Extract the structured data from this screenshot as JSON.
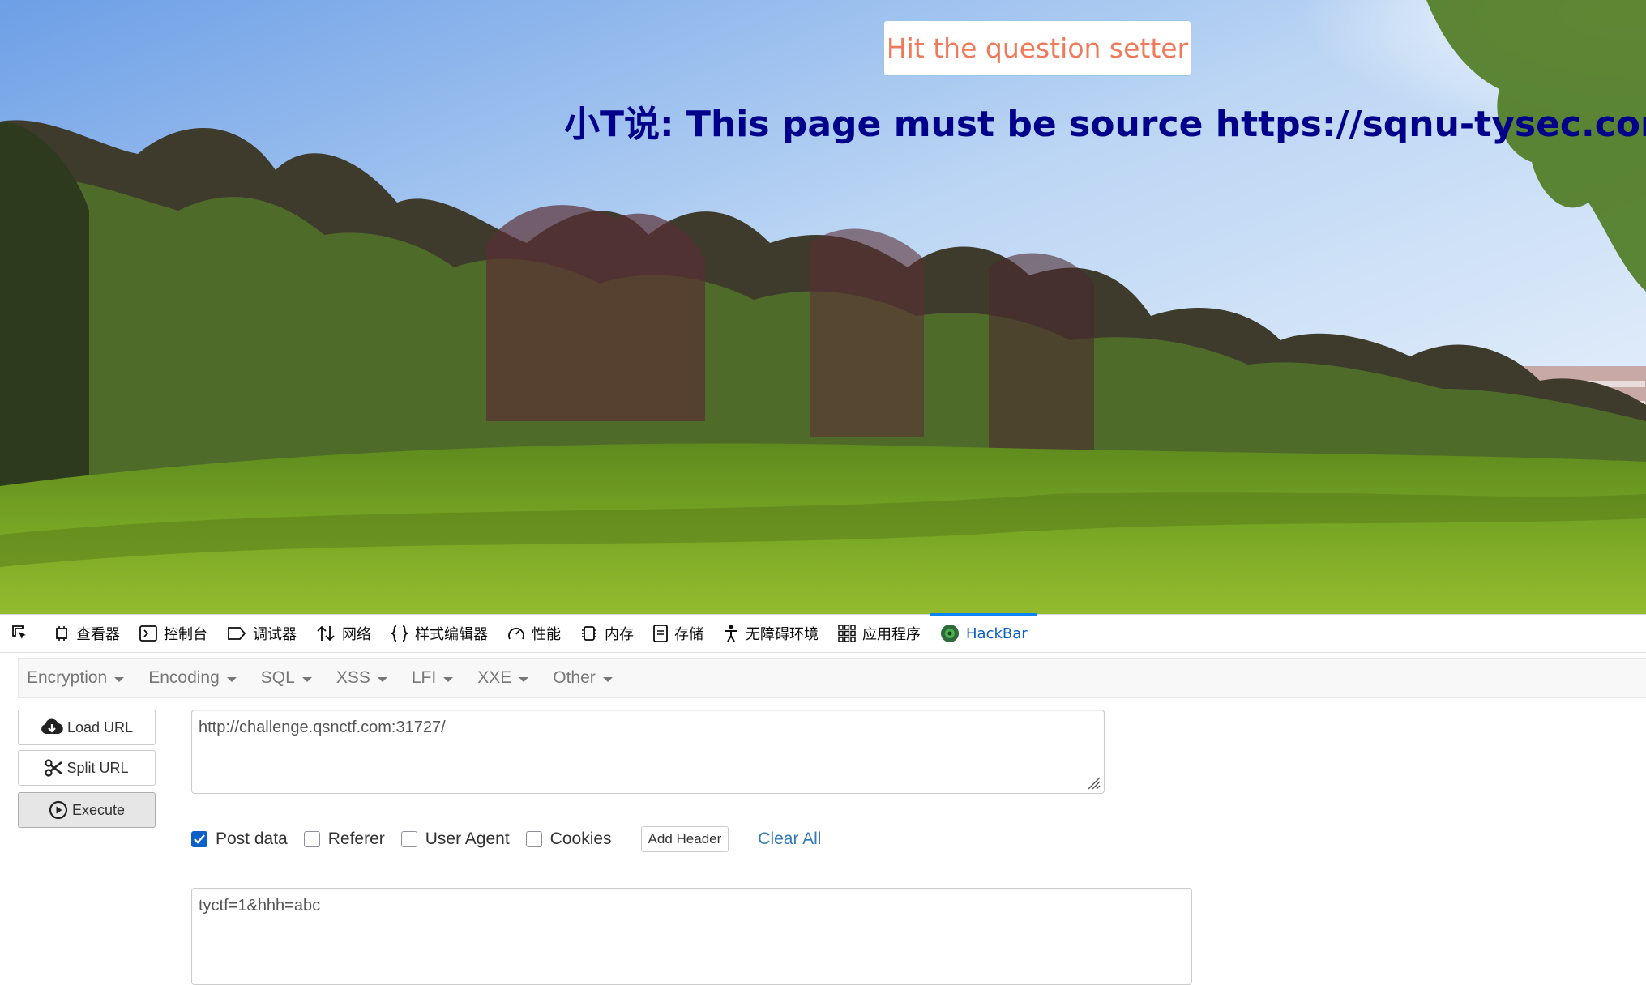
{
  "page": {
    "hit_button": "Hit the question setter",
    "headline": "小T说: This page must be source https://sqnu-tysec.com"
  },
  "devtools": {
    "tabs": [
      {
        "label": "查看器",
        "icon": "inspector-icon"
      },
      {
        "label": "控制台",
        "icon": "console-icon"
      },
      {
        "label": "调试器",
        "icon": "debugger-icon"
      },
      {
        "label": "网络",
        "icon": "network-icon"
      },
      {
        "label": "样式编辑器",
        "icon": "style-editor-icon"
      },
      {
        "label": "性能",
        "icon": "performance-icon"
      },
      {
        "label": "内存",
        "icon": "memory-icon"
      },
      {
        "label": "存储",
        "icon": "storage-icon"
      },
      {
        "label": "无障碍环境",
        "icon": "accessibility-icon"
      },
      {
        "label": "应用程序",
        "icon": "application-icon"
      },
      {
        "label": "HackBar",
        "icon": "hackbar-icon",
        "active": true
      }
    ]
  },
  "hackbar": {
    "menu": [
      "Encryption",
      "Encoding",
      "SQL",
      "XSS",
      "LFI",
      "XXE",
      "Other"
    ],
    "load_url": "Load URL",
    "split_url": "Split URL",
    "execute": "Execute",
    "url_value": "http://challenge.qsnctf.com:31727/",
    "options": [
      {
        "label": "Post data",
        "checked": true
      },
      {
        "label": "Referer",
        "checked": false
      },
      {
        "label": "User Agent",
        "checked": false
      },
      {
        "label": "Cookies",
        "checked": false
      }
    ],
    "add_header": "Add Header",
    "clear_all": "Clear All",
    "post_value": "tyctf=1&hhh=abc"
  },
  "colors": {
    "headline": "#00008b",
    "hit_button_text": "#f0795b",
    "active_tab": "#0a60c7"
  }
}
